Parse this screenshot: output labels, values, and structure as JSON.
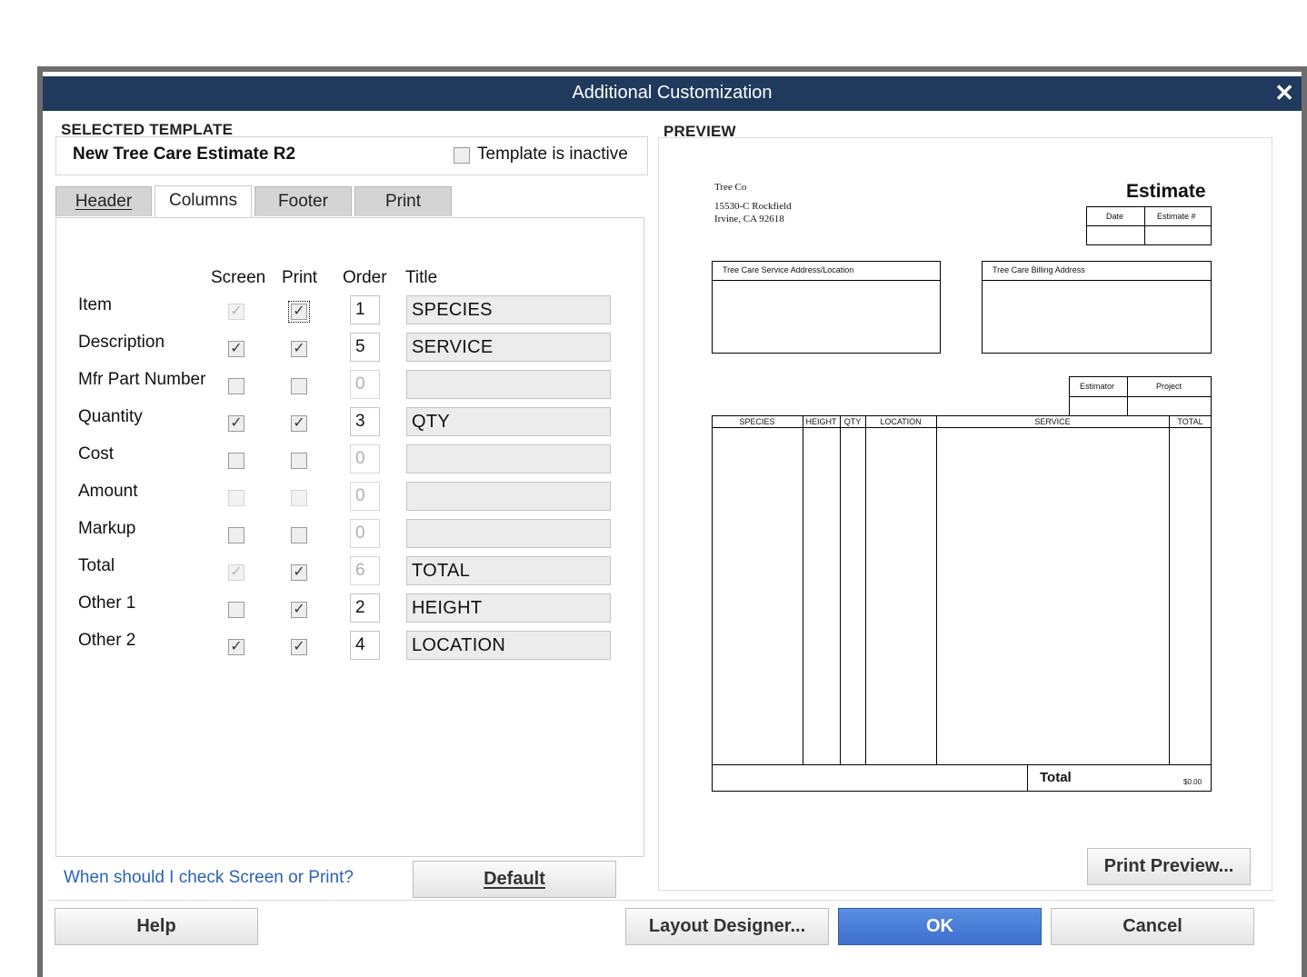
{
  "dialog": {
    "title": "Additional Customization"
  },
  "selected_template": {
    "section_label": "SELECTED TEMPLATE",
    "name": "New Tree Care Estimate R2",
    "inactive_label": "Template is inactive",
    "inactive_checked": false
  },
  "tabs": [
    {
      "label": "Header",
      "active": false
    },
    {
      "label": "Columns",
      "active": true
    },
    {
      "label": "Footer",
      "active": false
    },
    {
      "label": "Print",
      "active": false
    }
  ],
  "columns_table": {
    "headers": {
      "screen": "Screen",
      "print": "Print",
      "order": "Order",
      "title": "Title"
    },
    "rows": [
      {
        "label": "Item",
        "screen": "checked-disabled",
        "print": "checked",
        "order": "1",
        "title": "SPECIES"
      },
      {
        "label": "Description",
        "screen": "checked",
        "print": "checked",
        "order": "5",
        "title": "SERVICE"
      },
      {
        "label": "Mfr Part Number",
        "screen": "unchecked",
        "print": "unchecked",
        "order": "0",
        "title": ""
      },
      {
        "label": "Quantity",
        "screen": "checked",
        "print": "checked",
        "order": "3",
        "title": "QTY"
      },
      {
        "label": "Cost",
        "screen": "unchecked",
        "print": "unchecked",
        "order": "0",
        "title": ""
      },
      {
        "label": "Amount",
        "screen": "unchecked-disabled",
        "print": "unchecked-disabled",
        "order": "0",
        "title": ""
      },
      {
        "label": "Markup",
        "screen": "unchecked",
        "print": "unchecked",
        "order": "0",
        "title": ""
      },
      {
        "label": "Total",
        "screen": "checked-disabled",
        "print": "checked",
        "order": "6",
        "title": "TOTAL"
      },
      {
        "label": "Other 1",
        "screen": "unchecked",
        "print": "checked",
        "order": "2",
        "title": "HEIGHT"
      },
      {
        "label": "Other 2",
        "screen": "checked",
        "print": "checked",
        "order": "4",
        "title": "LOCATION"
      }
    ]
  },
  "help_link": "When should I check Screen or Print?",
  "default_button": "Default",
  "preview": {
    "section_label": "PREVIEW",
    "company_name": "Tree Co",
    "address_line1": "15530-C Rockfield",
    "address_line2": "Irvine, CA 92618",
    "doc_title": "Estimate",
    "date_label": "Date",
    "estimate_no_label": "Estimate #",
    "service_address_label": "Tree Care Service Address/Location",
    "billing_address_label": "Tree Care Billing Address",
    "estimator_label": "Estimator",
    "project_label": "Project",
    "columns": [
      "SPECIES",
      "HEIGHT",
      "QTY",
      "LOCATION",
      "SERVICE",
      "TOTAL"
    ],
    "total_label": "Total",
    "total_value": "$0.00",
    "print_preview_button": "Print Preview..."
  },
  "footer_buttons": {
    "help": "Help",
    "layout_designer": "Layout Designer...",
    "ok": "OK",
    "cancel": "Cancel"
  }
}
